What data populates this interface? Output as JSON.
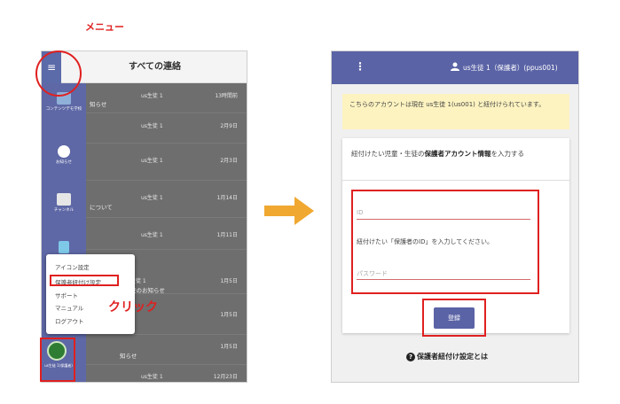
{
  "annotations": {
    "menu_label": "メニュー",
    "click_label": "クリック"
  },
  "left": {
    "header_title": "すべての連絡",
    "menu_icon": "hamburger-icon",
    "sidebar": [
      {
        "label": "コンテンツデモ学校"
      },
      {
        "label": "お知らせ"
      },
      {
        "label": "チャンネル"
      },
      {
        "label": ""
      }
    ],
    "rows": [
      {
        "name": "us生徒 1",
        "date": "13時間前",
        "sub": "知らせ"
      },
      {
        "name": "us生徒 1",
        "date": "2月9日",
        "sub": ""
      },
      {
        "name": "us生徒 1",
        "date": "2月3日",
        "sub": ""
      },
      {
        "name": "us生徒 1",
        "date": "1月14日",
        "sub": "について"
      },
      {
        "name": "us生徒 1",
        "date": "1月11日",
        "sub": ""
      },
      {
        "name": "生徒 1",
        "date": "1月5日",
        "sub": "校のお知らせ"
      },
      {
        "name": "",
        "date": "1月5日",
        "sub": ""
      },
      {
        "name": "",
        "date": "1月5日",
        "sub": "知らせ"
      },
      {
        "name": "us生徒 1",
        "date": "12月23日",
        "sub": ""
      }
    ],
    "popup": [
      "アイコン設定",
      "保護者紐付け設定",
      "サポート",
      "マニュアル",
      "ログアウト"
    ],
    "avatar_label": "us生徒 1(保護者)"
  },
  "right": {
    "header_user": "us生徒 1（保護者）(ppus001)",
    "notice": "こちらのアカウントは現在 us生徒 1(us001) と紐付けられています。",
    "card_head_pre": "紐付けたい児童・生徒の",
    "card_head_bold": "保護者アカウント情報",
    "card_head_post": "を入力する",
    "id_placeholder": "ID",
    "hint": "紐付けたい「保護者のID」を入力してください。",
    "password_placeholder": "パスワード",
    "submit": "登録",
    "help": "保護者紐付け設定とは"
  },
  "colors": {
    "accent": "#5a63a6",
    "highlight": "#e02020",
    "notice_bg": "#fdf3c0",
    "arrow": "#f0a830"
  }
}
